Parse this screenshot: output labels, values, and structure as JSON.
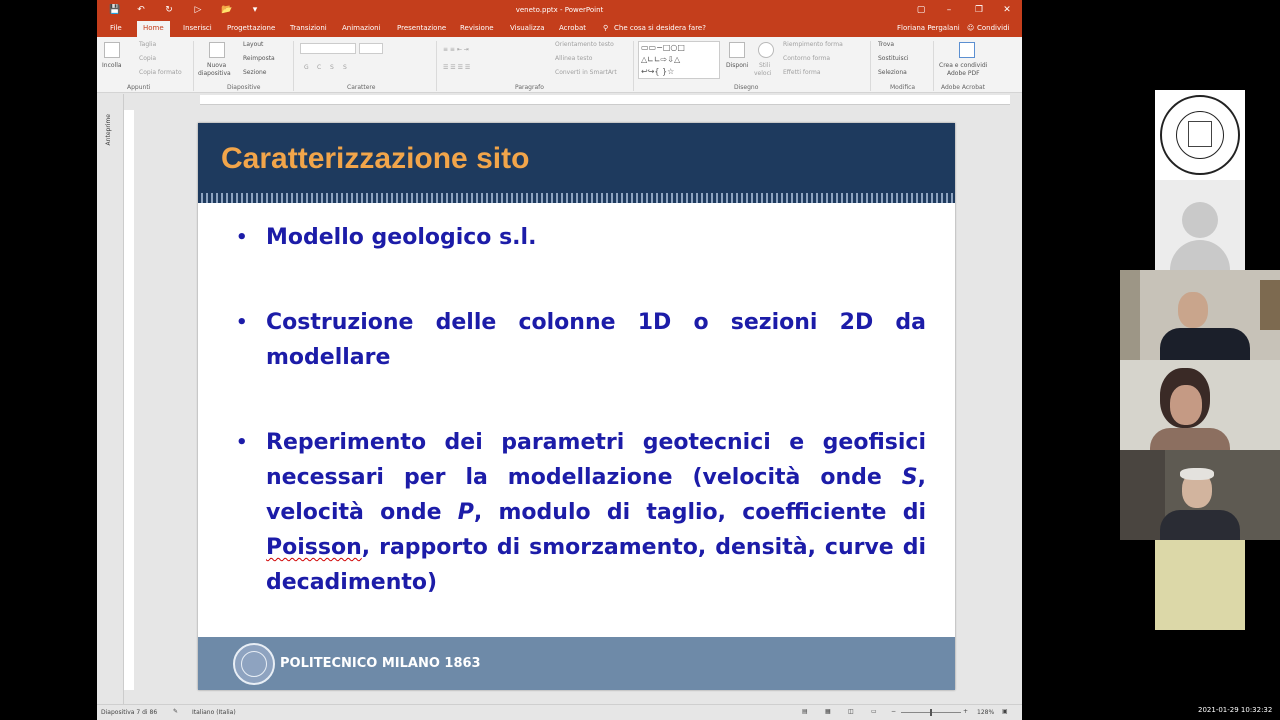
{
  "window": {
    "title": "veneto.pptx - PowerPoint",
    "user": "Floriana Pergalani",
    "share_label": "Condividi",
    "tell_me": "Che cosa si desidera fare?"
  },
  "tabs": [
    "File",
    "Home",
    "Inserisci",
    "Progettazione",
    "Transizioni",
    "Animazioni",
    "Presentazione",
    "Revisione",
    "Visualizza",
    "Acrobat"
  ],
  "ribbon": {
    "clipboard": {
      "paste": "Incolla",
      "cut": "Taglia",
      "copy": "Copia",
      "format": "Copia formato",
      "group": "Appunti"
    },
    "slides": {
      "new": "Nuova",
      "new2": "diapositiva",
      "layout": "Layout",
      "reset": "Reimposta",
      "section": "Sezione",
      "group": "Diapositive"
    },
    "font": {
      "group": "Carattere",
      "bold": "G",
      "italic": "C",
      "underline": "S",
      "strike": "S"
    },
    "paragraph": {
      "direction": "Orientamento testo",
      "align": "Allinea testo",
      "smartart": "Converti in SmartArt",
      "group": "Paragrafo"
    },
    "drawing": {
      "arrange": "Disponi",
      "styles": "Stili",
      "styles2": "veloci",
      "fill": "Riempimento forma",
      "outline": "Contorno forma",
      "effects": "Effetti forma",
      "group": "Disegno"
    },
    "editing": {
      "find": "Trova",
      "replace": "Sostituisci",
      "select": "Seleziona",
      "group": "Modifica"
    },
    "acrobat": {
      "create": "Crea e condividi",
      "create2": "Adobe PDF",
      "group": "Adobe Acrobat"
    }
  },
  "thumb_label": "Anteprime",
  "slide": {
    "title": "Caratterizzazione sito",
    "bullet1": "Modello geologico s.l.",
    "bullet2": "Costruzione delle colonne 1D o sezioni 2D da modellare",
    "bullet3_a": "Reperimento dei parametri geotecnici e geofisici necessari per la modellazione (velocità onde ",
    "bullet3_s": "S",
    "bullet3_b": ", velocità onde ",
    "bullet3_p": "P",
    "bullet3_c": ", modulo di taglio, coefficiente di ",
    "bullet3_poisson": "Poisson",
    "bullet3_d": ", rapporto di smorzamento, densità, curve di decadimento)",
    "footer": "POLITECNICO MILANO 1863"
  },
  "status": {
    "slide_counter": "Diapositiva 7 di 86",
    "language": "Italiano (Italia)",
    "zoom": "128%"
  },
  "clock": "2021-01-29 10:32:32",
  "colors": {
    "ppt_accent": "#c43e1c",
    "slide_header": "#1e3a5e",
    "title_orange": "#f2a54a",
    "bullet_blue": "#1c1ca8",
    "footer_blue": "#6e8aa8"
  }
}
